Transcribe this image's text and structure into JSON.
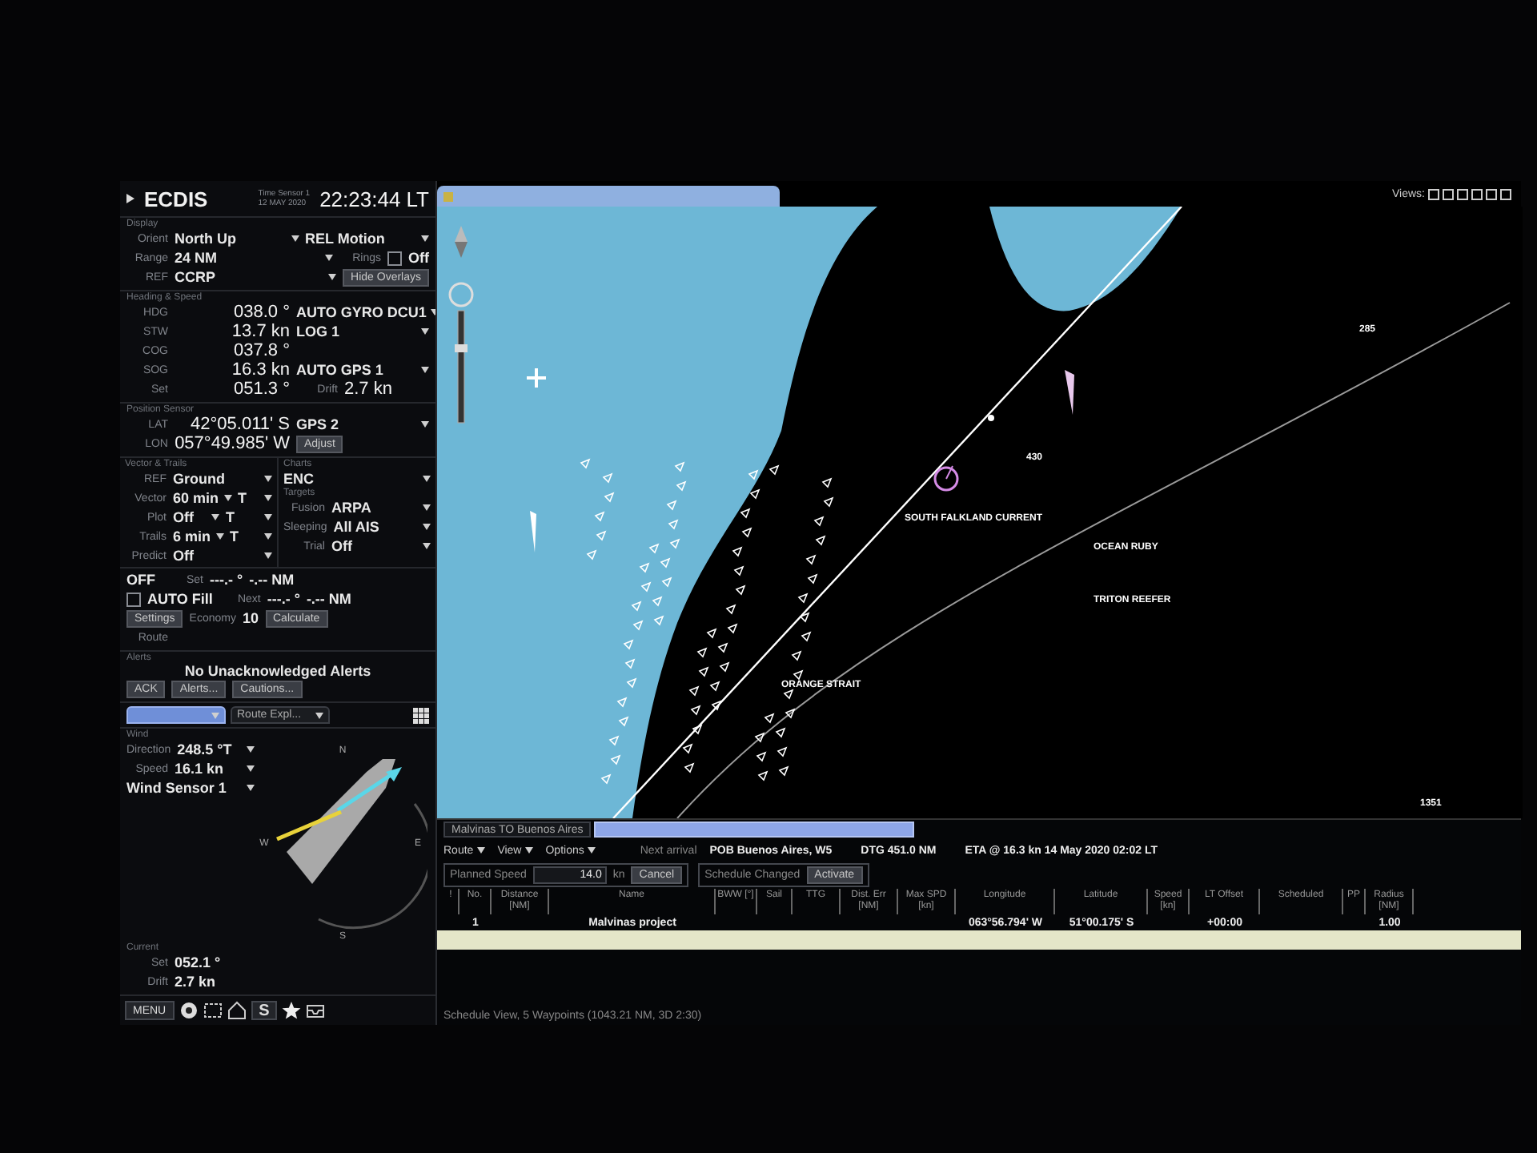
{
  "header": {
    "title": "ECDIS",
    "time_source": "Time Sensor 1",
    "date": "12 MAY 2020",
    "time": "22:23:44 LT"
  },
  "left": {
    "sections": [
      {
        "kind": "rows",
        "heading": "Display",
        "rows": [
          [
            {
              "kind": "label",
              "text": "Orient"
            },
            {
              "kind": "select",
              "text": "North Up"
            },
            {
              "kind": "select",
              "text": "REL Motion"
            }
          ],
          [
            {
              "kind": "label",
              "text": "Range"
            },
            {
              "kind": "select",
              "text": "24 NM"
            },
            {
              "kind": "label",
              "text": "Rings"
            },
            {
              "kind": "check",
              "checked": false
            },
            {
              "kind": "value",
              "text": "Off"
            }
          ],
          [
            {
              "kind": "label",
              "text": "REF"
            },
            {
              "kind": "select",
              "text": "CCRP"
            },
            {
              "kind": "button",
              "text": "Hide Overlays"
            }
          ]
        ]
      },
      {
        "kind": "rows",
        "heading": "Heading & Speed",
        "rows": [
          [
            {
              "kind": "label",
              "text": "HDG"
            },
            {
              "kind": "big",
              "text": "038.0 °"
            },
            {
              "kind": "select",
              "text": "AUTO GYRO DCU1"
            }
          ],
          [
            {
              "kind": "label",
              "text": "STW"
            },
            {
              "kind": "big",
              "text": "13.7 kn"
            },
            {
              "kind": "select",
              "text": "LOG 1"
            }
          ],
          [
            {
              "kind": "label",
              "text": "COG"
            },
            {
              "kind": "big",
              "text": "037.8 °"
            }
          ],
          [
            {
              "kind": "label",
              "text": "SOG"
            },
            {
              "kind": "big",
              "text": "16.3 kn"
            },
            {
              "kind": "select",
              "text": "AUTO GPS 1"
            }
          ],
          [
            {
              "kind": "label",
              "text": "Set"
            },
            {
              "kind": "big",
              "text": "051.3 °"
            },
            {
              "kind": "label",
              "text": "Drift"
            },
            {
              "kind": "big",
              "text": "2.7 kn"
            }
          ]
        ]
      },
      {
        "kind": "rows",
        "heading": "Position Sensor",
        "rows": [
          [
            {
              "kind": "label",
              "text": "LAT"
            },
            {
              "kind": "big",
              "text": "42°05.011' S"
            },
            {
              "kind": "select",
              "text": "GPS 2"
            }
          ],
          [
            {
              "kind": "label",
              "text": "LON"
            },
            {
              "kind": "big",
              "text": "057°49.985' W"
            },
            {
              "kind": "button",
              "text": "Adjust"
            }
          ]
        ]
      },
      {
        "kind": "split",
        "columns": [
          [
            {
              "heading": "Vector & Trails",
              "rows": [
                [
                  {
                    "kind": "label",
                    "text": "REF"
                  },
                  {
                    "kind": "select",
                    "text": "Ground"
                  }
                ],
                [
                  {
                    "kind": "label",
                    "text": "Vector"
                  },
                  {
                    "kind": "select",
                    "text": "60 min"
                  },
                  {
                    "kind": "select",
                    "text": "T"
                  }
                ],
                [
                  {
                    "kind": "label",
                    "text": "Plot"
                  },
                  {
                    "kind": "select",
                    "text": "Off"
                  },
                  {
                    "kind": "select",
                    "text": "T"
                  }
                ],
                [
                  {
                    "kind": "label",
                    "text": "Trails"
                  },
                  {
                    "kind": "select",
                    "text": "6 min"
                  },
                  {
                    "kind": "select",
                    "text": "T"
                  }
                ],
                [
                  {
                    "kind": "label",
                    "text": "Predict"
                  },
                  {
                    "kind": "select",
                    "text": "Off"
                  }
                ]
              ]
            }
          ],
          [
            {
              "heading": "Charts",
              "rows": [
                [
                  {
                    "kind": "select",
                    "text": "ENC"
                  }
                ]
              ]
            },
            {
              "heading": "Targets",
              "rows": [
                [
                  {
                    "kind": "label",
                    "text": "Fusion"
                  },
                  {
                    "kind": "select",
                    "text": "ARPA"
                  }
                ],
                [
                  {
                    "kind": "label",
                    "text": "Sleeping"
                  },
                  {
                    "kind": "select",
                    "text": "All AIS"
                  }
                ],
                [
                  {
                    "kind": "label",
                    "text": "Trial"
                  },
                  {
                    "kind": "select",
                    "text": "Off"
                  }
                ]
              ]
            }
          ]
        ]
      },
      {
        "kind": "rows",
        "rows": [
          [
            {
              "kind": "value",
              "text": "OFF"
            },
            {
              "kind": "label",
              "text": "Set"
            },
            {
              "kind": "value",
              "text": "---.- °"
            },
            {
              "kind": "value",
              "text": "-.-- NM"
            }
          ],
          [
            {
              "kind": "check",
              "checked": false
            },
            {
              "kind": "value",
              "text": "AUTO Fill"
            },
            {
              "kind": "label",
              "text": "Next"
            },
            {
              "kind": "value",
              "text": "---.- °"
            },
            {
              "kind": "value",
              "text": "-.-- NM"
            }
          ],
          [
            {
              "kind": "button",
              "text": "Settings"
            },
            {
              "kind": "label",
              "text": "Economy"
            },
            {
              "kind": "value",
              "text": "10"
            },
            {
              "kind": "button",
              "text": "Calculate"
            }
          ],
          [
            {
              "kind": "label",
              "text": "Route"
            }
          ]
        ]
      },
      {
        "kind": "alerts",
        "heading": "Alerts",
        "title": "No Unacknowledged Alerts",
        "buttons": [
          "ACK",
          "Alerts...",
          "Cautions..."
        ]
      },
      {
        "kind": "tabs",
        "tabs": [
          {
            "selected": true
          },
          {
            "label": "Route Expl...",
            "selected": false
          }
        ]
      },
      {
        "kind": "wind",
        "heading": "Wind",
        "rows": [
          [
            {
              "kind": "label",
              "text": "Direction"
            },
            {
              "kind": "select",
              "text": "248.5 °T"
            }
          ],
          [
            {
              "kind": "label",
              "text": "Speed"
            },
            {
              "kind": "select",
              "text": "16.1 kn"
            }
          ],
          [
            {
              "kind": "select",
              "text": "Wind Sensor 1"
            }
          ]
        ],
        "compass_labels": [
          "N",
          "E",
          "S",
          "W"
        ],
        "current": {
          "heading": "Current",
          "rows": [
            [
              {
                "kind": "label",
                "text": "Set"
              },
              {
                "kind": "value",
                "text": "052.1 °"
              }
            ],
            [
              {
                "kind": "label",
                "text": "Drift"
              },
              {
                "kind": "value",
                "text": "2.7 kn"
              }
            ]
          ]
        }
      },
      {
        "kind": "toolbar",
        "buttons": [
          "MENU",
          "S"
        ]
      }
    ]
  },
  "chart": {
    "views_label": "Views:",
    "labels": [
      "SOUTH FALKLAND CURRENT",
      "OCEAN RUBY",
      "TRITON REEFER",
      "ORANGE STRAIT",
      "285",
      "430",
      "1351"
    ]
  },
  "route": {
    "tabs": [
      {
        "label": "Malvinas TO Buenos Aires",
        "selected": false
      },
      {
        "selected": true
      }
    ],
    "menus": [
      "Route",
      "View",
      "Options"
    ],
    "next_arrival_label": "Next arrival",
    "next_arrival": "POB Buenos Aires, W5",
    "dtg": "DTG 451.0 NM",
    "eta": "ETA @ 16.3 kn 14 May 2020 02:02 LT",
    "planned_speed": {
      "label": "Planned Speed",
      "value": "14.0",
      "unit": "kn",
      "button": "Cancel"
    },
    "schedule": {
      "label": "Schedule Changed",
      "button": "Activate"
    },
    "table": {
      "columns": [
        "!",
        "No.",
        "Distance [NM]",
        "Name",
        "BWW [°]",
        "Sail",
        "TTG",
        "Dist. Err [NM]",
        "Max SPD [kn]",
        "Longitude",
        "Latitude",
        "Speed [kn]",
        "LT Offset",
        "Scheduled",
        "PP",
        "Radius [NM]"
      ],
      "rows": [
        {
          "selected": false,
          "cells": [
            null,
            "1",
            null,
            "Malvinas project",
            null,
            null,
            null,
            null,
            null,
            "063°56.794' W",
            "51°00.175' S",
            null,
            "+00:00",
            null,
            null,
            "1.00"
          ]
        },
        {
          "selected": true
        }
      ]
    },
    "status": "Schedule View, 5 Waypoints (1043.21 NM, 3D 2:30)"
  }
}
